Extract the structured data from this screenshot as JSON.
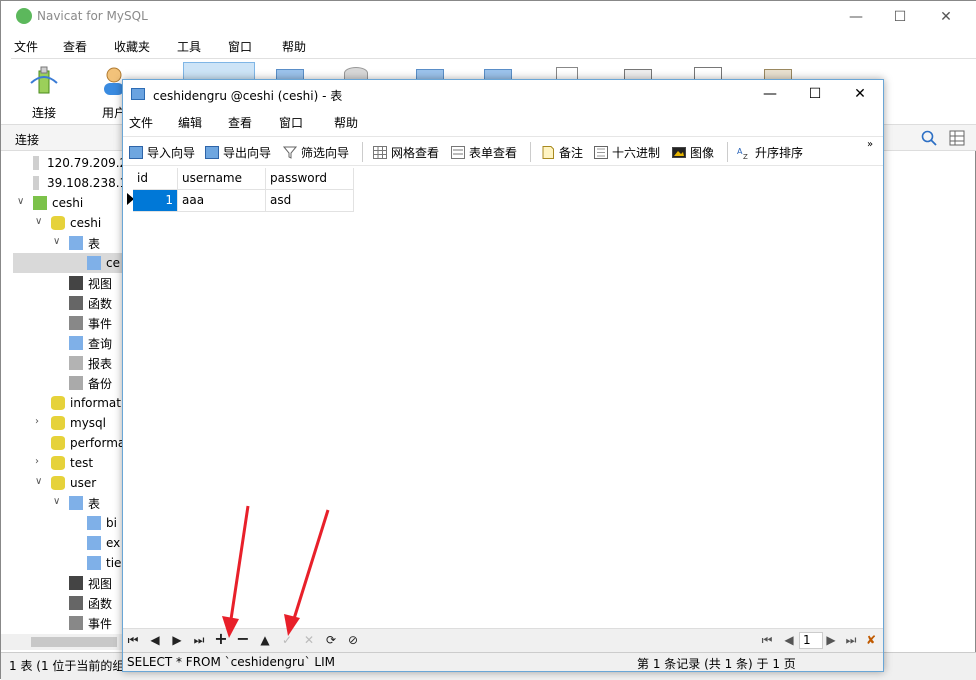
{
  "main_window": {
    "title": "Navicat for MySQL",
    "menu": [
      "文件",
      "查看",
      "收藏夹",
      "工具",
      "窗口",
      "帮助"
    ],
    "toolbar": [
      {
        "label": "连接",
        "icon": "connect-icon"
      },
      {
        "label": "用户",
        "icon": "user-icon"
      }
    ],
    "connections_header": "连接",
    "tree": [
      {
        "label": "120.79.209.2",
        "icon": "server-icon",
        "level": 0,
        "toggle": ""
      },
      {
        "label": "39.108.238.1",
        "icon": "server-icon",
        "level": 0,
        "toggle": ""
      },
      {
        "label": "ceshi",
        "icon": "connection-icon",
        "level": 0,
        "toggle": "open"
      },
      {
        "label": "ceshi",
        "icon": "database-icon",
        "level": 1,
        "toggle": "open"
      },
      {
        "label": "表",
        "icon": "tables-icon",
        "level": 2,
        "toggle": "open"
      },
      {
        "label": "ce",
        "icon": "table-icon",
        "level": 3,
        "toggle": "",
        "selected": true
      },
      {
        "label": "视图",
        "icon": "view-icon",
        "level": 2,
        "toggle": ""
      },
      {
        "label": "函数",
        "icon": "function-icon",
        "level": 2,
        "toggle": ""
      },
      {
        "label": "事件",
        "icon": "event-icon",
        "level": 2,
        "toggle": ""
      },
      {
        "label": "查询",
        "icon": "query-icon",
        "level": 2,
        "toggle": ""
      },
      {
        "label": "报表",
        "icon": "report-icon",
        "level": 2,
        "toggle": ""
      },
      {
        "label": "备份",
        "icon": "backup-icon",
        "level": 2,
        "toggle": ""
      },
      {
        "label": "informat",
        "icon": "database-icon",
        "level": 1,
        "toggle": ""
      },
      {
        "label": "mysql",
        "icon": "database-icon",
        "level": 1,
        "toggle": "closed"
      },
      {
        "label": "performa",
        "icon": "database-icon",
        "level": 1,
        "toggle": ""
      },
      {
        "label": "test",
        "icon": "database-icon",
        "level": 1,
        "toggle": "closed"
      },
      {
        "label": "user",
        "icon": "database-icon",
        "level": 1,
        "toggle": "open"
      },
      {
        "label": "表",
        "icon": "tables-icon",
        "level": 2,
        "toggle": "open"
      },
      {
        "label": "bi",
        "icon": "table-icon",
        "level": 3,
        "toggle": ""
      },
      {
        "label": "ex",
        "icon": "table-icon",
        "level": 3,
        "toggle": ""
      },
      {
        "label": "tie",
        "icon": "table-icon",
        "level": 3,
        "toggle": ""
      },
      {
        "label": "视图",
        "icon": "view-icon",
        "level": 2,
        "toggle": ""
      },
      {
        "label": "函数",
        "icon": "function-icon",
        "level": 2,
        "toggle": ""
      },
      {
        "label": "事件",
        "icon": "event-icon",
        "level": 2,
        "toggle": ""
      }
    ],
    "status": "1 表 (1 位于当前的组"
  },
  "child_window": {
    "title": "ceshidengru @ceshi (ceshi) - 表",
    "menu": [
      "文件",
      "编辑",
      "查看",
      "窗口",
      "帮助"
    ],
    "toolbar": [
      {
        "label": "导入向导",
        "icon": "import-icon"
      },
      {
        "label": "导出向导",
        "icon": "export-icon"
      },
      {
        "label": "筛选向导",
        "icon": "filter-icon"
      },
      {
        "label": "网格查看",
        "icon": "grid-view-icon"
      },
      {
        "label": "表单查看",
        "icon": "form-view-icon"
      },
      {
        "label": "备注",
        "icon": "memo-icon"
      },
      {
        "label": "十六进制",
        "icon": "hex-icon"
      },
      {
        "label": "图像",
        "icon": "image-icon"
      },
      {
        "label": "升序排序",
        "icon": "sort-asc-icon"
      }
    ],
    "grid": {
      "columns": [
        "id",
        "username",
        "password"
      ],
      "rows": [
        [
          "1",
          "aaa",
          "asd"
        ]
      ]
    },
    "nav": {
      "page": "1"
    },
    "status_sql": "SELECT * FROM `ceshidengru` LIM",
    "status_record": "第 1 条记录 (共 1 条) 于 1 页"
  },
  "accent_color": "#0078d7"
}
